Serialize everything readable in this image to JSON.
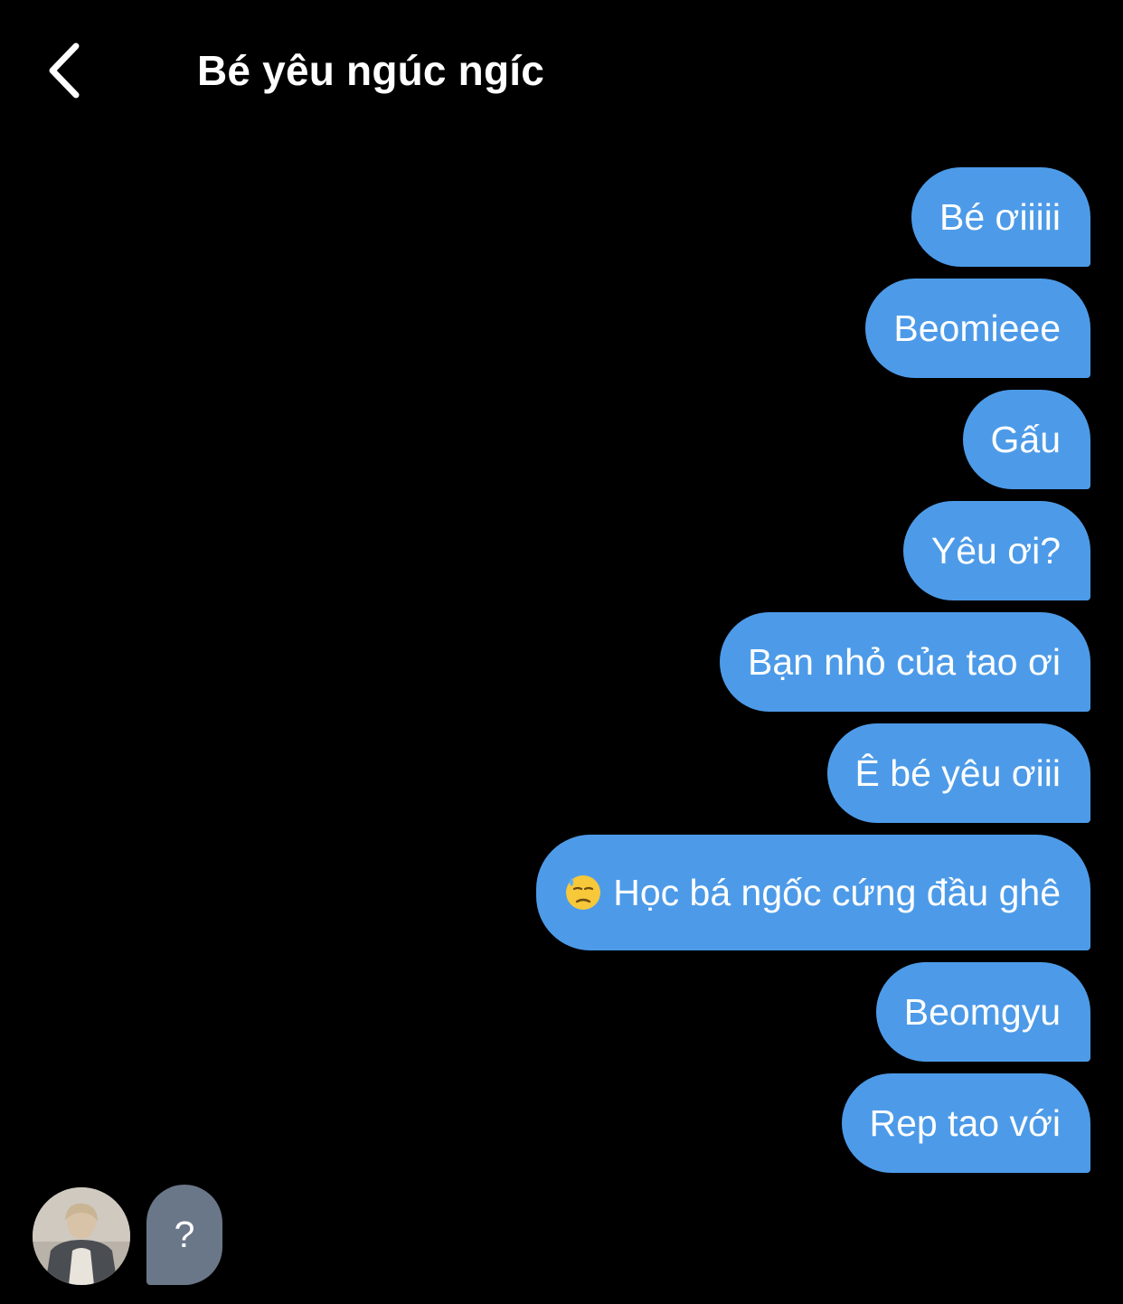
{
  "header": {
    "title": "Bé yêu ngúc ngíc",
    "back_icon": "chevron-left-icon"
  },
  "messages_outgoing": [
    {
      "text": "Bé ơiiiii"
    },
    {
      "text": "Beomieee"
    },
    {
      "text": "Gấu"
    },
    {
      "text": "Yêu ơi?"
    },
    {
      "text": "Bạn nhỏ của tao ơi"
    },
    {
      "text": "Ê bé yêu ơiii"
    },
    {
      "text": "Học bá ngốc cứng đầu ghê",
      "emoji": "downcast-face-with-sweat-icon"
    },
    {
      "text": "Beomgyu"
    },
    {
      "text": "Rep tao với"
    }
  ],
  "messages_incoming": [
    {
      "text": "?"
    }
  ],
  "colors": {
    "background": "#000000",
    "outgoing_bubble": "#4d9be8",
    "incoming_bubble": "#6a7788",
    "text": "#ffffff"
  }
}
